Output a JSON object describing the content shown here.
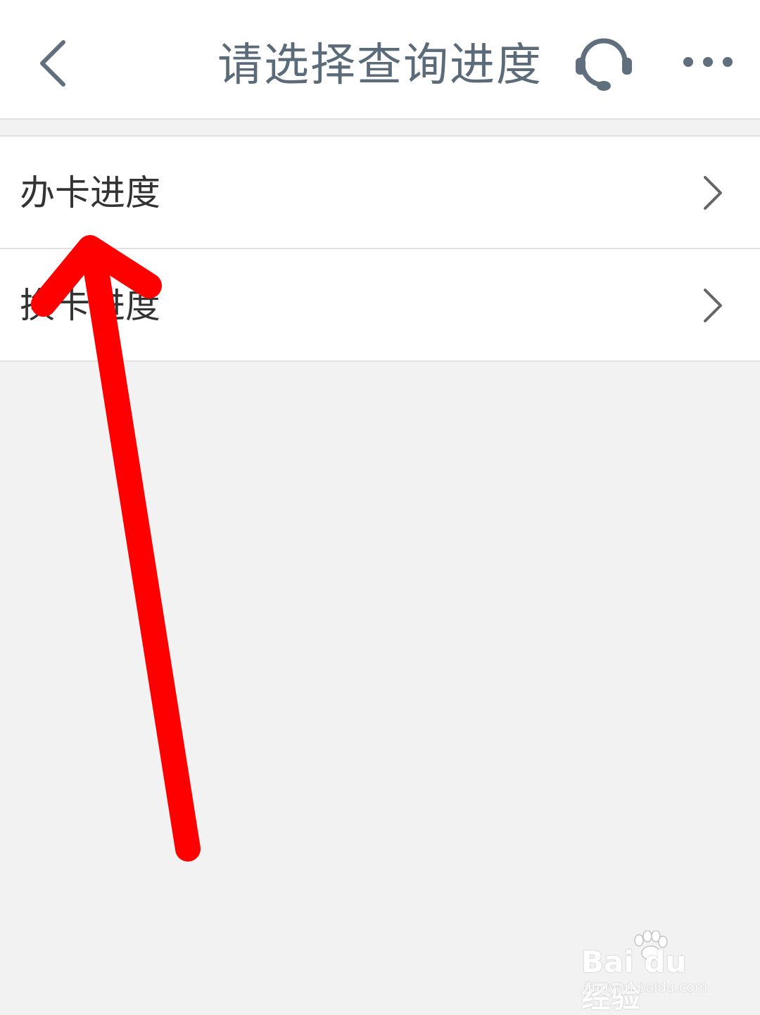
{
  "header": {
    "title": "请选择查询进度",
    "back_icon": "chevron-left-icon",
    "support_icon": "headset-icon",
    "more_icon": "more-horizontal-icon"
  },
  "list": {
    "items": [
      {
        "label": "办卡进度",
        "icon": "chevron-right-icon"
      },
      {
        "label": "换卡进度",
        "icon": "chevron-right-icon"
      }
    ]
  },
  "watermark": {
    "brand": "Bai du 经验",
    "url": "jingyan.baidu.com"
  },
  "colors": {
    "annotation_arrow": "#ff0000",
    "title_text": "#5b6b7a",
    "page_background": "#f2f2f2"
  }
}
